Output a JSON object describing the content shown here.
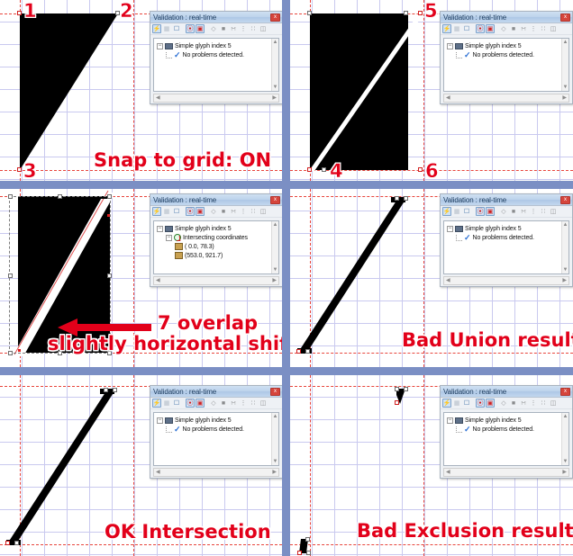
{
  "meta": {
    "app_context": "Font editor glyph outline boolean-operation comparison sheet",
    "accent_red": "#e2001a",
    "grid_color": "#c9c9ef",
    "guide_color": "#e8453c",
    "divider_color": "#7b8fc4"
  },
  "validation_window": {
    "title": "Validation : real-time",
    "close_label": "x",
    "toolbar_icons": [
      "lightning-icon",
      "document-icon",
      "copy-icon",
      "validate-all-icon",
      "validate-glyph-icon",
      "point-icon",
      "square-icon",
      "align-nodes-icon",
      "measure-icon",
      "distribute-icon",
      "corner-icon"
    ],
    "scroll_up": "▲",
    "scroll_down": "▼",
    "scroll_left": "◀",
    "scroll_right": "▶",
    "tree_ok": {
      "root": "Simple glyph index 5",
      "child": "No problems detected."
    },
    "tree_error": {
      "root": "Simple glyph index 5",
      "child": "Intersecting coordinates",
      "coords": [
        "( 0.0, 78.3)",
        "(553.0, 921.7)"
      ]
    }
  },
  "panels": [
    {
      "id": "panel-1",
      "position": "top-left",
      "caption": "Snap to grid: ON",
      "point_labels": [
        "1",
        "2",
        "3"
      ],
      "shape": "filled right-triangle with vertices at top-left, top-right and bottom-left",
      "validation_state": "ok"
    },
    {
      "id": "panel-2",
      "position": "top-right",
      "caption": "",
      "point_labels": [
        "4",
        "5",
        "6"
      ],
      "shape": "filled rectangle with thin white diagonal gap separating two triangles",
      "validation_state": "ok"
    },
    {
      "id": "panel-3",
      "position": "middle-left",
      "caption_lines": [
        "7 overlap",
        "slightly horizontal shift"
      ],
      "point_labels": [],
      "shape": "filled rectangle with wide white diagonal band, outline selected with handles",
      "validation_state": "error",
      "annotation_arrow": "left-pointing-arrow"
    },
    {
      "id": "panel-4",
      "position": "middle-right",
      "caption": "Bad Union result",
      "point_labels": [],
      "shape": "thin diagonal black bar from bottom-left to top-right",
      "validation_state": "ok"
    },
    {
      "id": "panel-5",
      "position": "bottom-left",
      "caption": "OK Intersection",
      "point_labels": [],
      "shape": "thin diagonal black bar from bottom-left to top-right",
      "validation_state": "ok"
    },
    {
      "id": "panel-6",
      "position": "bottom-right",
      "caption": "Bad Exclusion result",
      "point_labels": [],
      "shape": "two tiny black triangular slivers at the diagonal endpoints",
      "validation_state": "ok"
    }
  ]
}
